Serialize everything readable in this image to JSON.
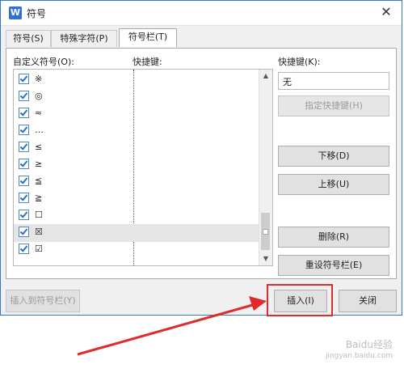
{
  "window": {
    "app_icon": "W",
    "title": "符号"
  },
  "tabs": [
    {
      "label": "符号(S)"
    },
    {
      "label": "特殊字符(P)"
    },
    {
      "label": "符号栏(T)"
    }
  ],
  "panel": {
    "custom_symbols_label": "自定义符号(O):",
    "shortcut_column_label": "快捷键:",
    "shortcut_key_label": "快捷键(K):",
    "shortcut_key_value": "无",
    "rows": [
      {
        "symbol": "※"
      },
      {
        "symbol": "◎"
      },
      {
        "symbol": "≈"
      },
      {
        "symbol": "…"
      },
      {
        "symbol": "≤"
      },
      {
        "symbol": "≥"
      },
      {
        "symbol": "≦"
      },
      {
        "symbol": "≧"
      },
      {
        "symbol": "☐"
      },
      {
        "symbol": "☒"
      },
      {
        "symbol": "☑"
      }
    ],
    "buttons": {
      "assign_shortcut": "指定快捷键(H)",
      "move_down": "下移(D)",
      "move_up": "上移(U)",
      "delete": "删除(R)",
      "reset": "重设符号栏(E)"
    }
  },
  "footer": {
    "insert_to_bar": "插入到符号栏(Y)",
    "insert": "插入(I)",
    "close": "关闭"
  },
  "watermark": {
    "line1": "Baidu经验",
    "line2": "jingyan.baidu.com"
  },
  "colors": {
    "highlight": "#e12a2a",
    "accent": "#2f6fdd"
  }
}
